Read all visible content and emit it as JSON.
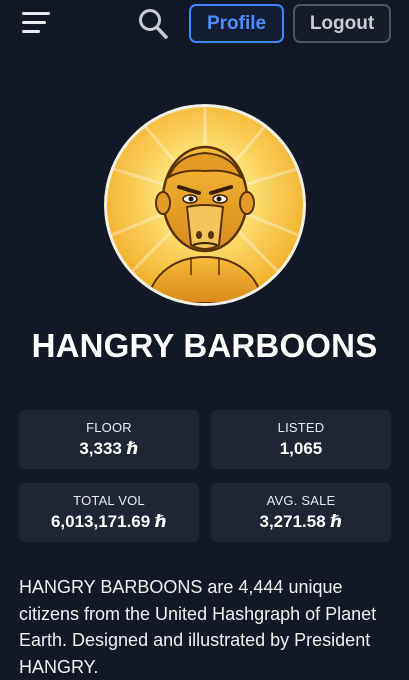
{
  "header": {
    "menu_icon": "hamburger-menu-icon",
    "search_icon": "search-icon",
    "profile_label": "Profile",
    "logout_label": "Logout"
  },
  "collection": {
    "name": "HANGRY BARBOONS",
    "avatar": "baboon-avatar",
    "description": "HANGRY BARBOONS are 4,444 unique citizens from the United Hashgraph of Planet Earth. Designed and illustrated by President HANGRY."
  },
  "stats": [
    {
      "label": "FLOOR",
      "value": "3,333 ℏ"
    },
    {
      "label": "LISTED",
      "value": "1,065"
    },
    {
      "label": "TOTAL VOL",
      "value": "6,013,171.69 ℏ"
    },
    {
      "label": "AVG. SALE",
      "value": "3,271.58 ℏ"
    }
  ],
  "colors": {
    "background": "#121826",
    "card": "#1e2535",
    "accent": "#3e84ff",
    "avatar_gold": "#f4b733"
  }
}
